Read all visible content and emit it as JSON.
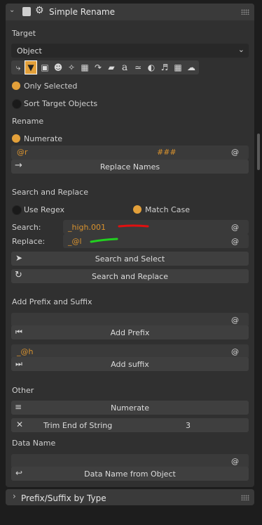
{
  "panel": {
    "title": "Simple Rename"
  },
  "target": {
    "heading": "Target",
    "dropdown_value": "Object",
    "type_icons": [
      "wrench-icon",
      "funnel-icon",
      "camera-icon",
      "skull-icon",
      "armature-icon",
      "stroke-icon",
      "curve-icon",
      "text-a-icon",
      "grease-pencil-icon",
      "paint-icon",
      "speaker-icon",
      "pattern-icon",
      "cloud-icon"
    ],
    "only_selected": "Only Selected",
    "sort_target": "Sort Target Objects"
  },
  "rename": {
    "heading": "Rename",
    "numerate": "Numerate",
    "field_left": "@r",
    "field_mid": "###",
    "at": "@",
    "replace_names": "Replace Names"
  },
  "search_replace": {
    "heading": "Search and Replace",
    "use_regex": "Use Regex",
    "match_case": "Match Case",
    "search_label": "Search:",
    "search_value": "_high.001",
    "replace_label": "Replace:",
    "replace_value": "_@l",
    "at": "@",
    "search_select": "Search and Select",
    "search_replace_btn": "Search and Replace"
  },
  "prefix_suffix": {
    "heading": "Add Prefix and Suffix",
    "at": "@",
    "add_prefix": "Add Prefix",
    "suffix_value": "_@h",
    "add_suffix": "Add suffix"
  },
  "other": {
    "heading": "Other",
    "numerate": "Numerate",
    "trim": "Trim End of String",
    "trim_value": "3"
  },
  "data_name": {
    "heading": "Data Name",
    "at": "@",
    "button": "Data Name from Object"
  },
  "collapsed": {
    "title": "Prefix/Suffix by Type"
  },
  "colors": {
    "accent": "#e3a03a",
    "field_text": "#d8922e",
    "annotation_red": "#e01010",
    "annotation_green": "#22d020"
  }
}
